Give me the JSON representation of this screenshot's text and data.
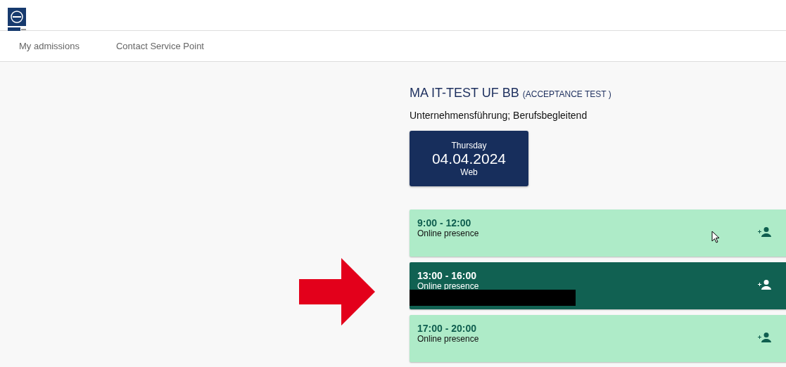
{
  "nav": {
    "items": [
      {
        "label": "My admissions"
      },
      {
        "label": "Contact Service Point"
      }
    ]
  },
  "course": {
    "title": "MA IT-TEST UF BB",
    "tag": "(ACCEPTANCE TEST )",
    "subtitle": "Unternehmensführung; Berufsbegleitend"
  },
  "date_card": {
    "weekday": "Thursday",
    "date": "04.04.2024",
    "location": "Web"
  },
  "slots": [
    {
      "time": "9:00 - 12:00",
      "mode": "Online presence",
      "selected": false
    },
    {
      "time": "13:00 - 16:00",
      "mode": "Online presence",
      "selected": true
    },
    {
      "time": "17:00 - 20:00",
      "mode": "Online presence",
      "selected": false
    }
  ]
}
